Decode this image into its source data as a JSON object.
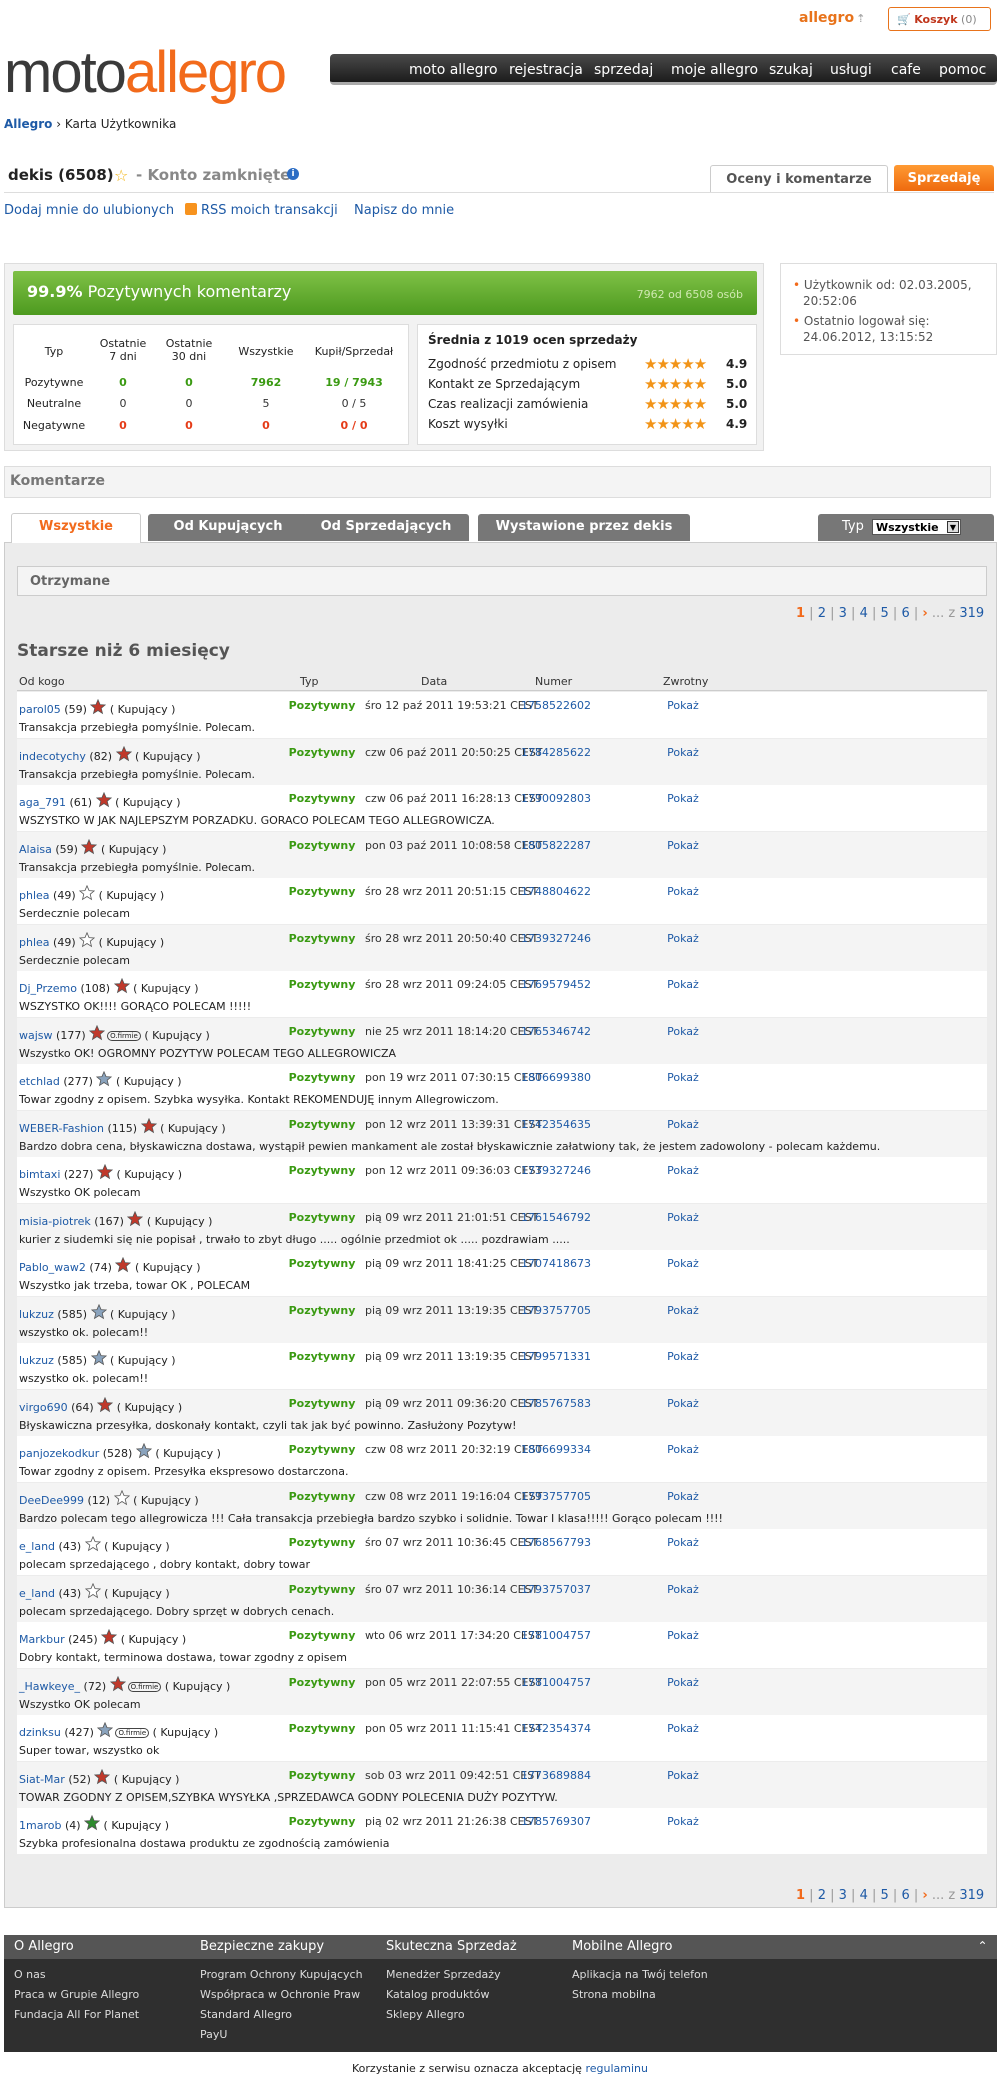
{
  "top": {
    "allegro_link": "allegro",
    "cart_label": "Koszyk",
    "cart_count": "(0)"
  },
  "logo": {
    "part1": "moto",
    "part2": "allegro"
  },
  "nav": [
    "moto allegro",
    "rejestracja",
    "sprzedaj",
    "moje allegro",
    "szukaj",
    "usługi",
    "cafe",
    "pomoc"
  ],
  "breadcrumb": {
    "root": "Allegro",
    "sep": "›",
    "current": "Karta Użytkownika"
  },
  "user": {
    "name": "dekis (6508)",
    "status": "- Konto zamknięte",
    "tab_oceny": "Oceny i komentarze",
    "tab_sprzedaje": "Sprzedaję"
  },
  "actions": {
    "fav": "Dodaj mnie do ulubionych",
    "rss": "RSS moich transakcji",
    "write": "Napisz do mnie"
  },
  "summary": {
    "percent": "99.9%",
    "positive_label": "Pozytywnych komentarzy",
    "count_text": "7962 od 6508 osób",
    "headers": [
      "Typ",
      "Ostatnie 7 dni",
      "Ostatnie 30 dni",
      "Wszystkie",
      "Kupił/Sprzedał"
    ],
    "rows": [
      {
        "typ": "Pozytywne",
        "d7": "0",
        "d30": "0",
        "all": "7962",
        "ks": "19 / 7943",
        "color": "#3a9a12"
      },
      {
        "typ": "Neutralne",
        "d7": "0",
        "d30": "0",
        "all": "5",
        "ks": "0 / 5",
        "color": "#333333"
      },
      {
        "typ": "Negatywne",
        "d7": "0",
        "d30": "0",
        "all": "0",
        "ks": "0 / 0",
        "color": "#e53b17"
      }
    ],
    "ratings_title": "Średnia z 1019 ocen sprzedaży",
    "ratings": [
      {
        "label": "Zgodność przedmiotu z opisem",
        "value": "4.9",
        "stars": "★★★★★"
      },
      {
        "label": "Kontakt ze Sprzedającym",
        "value": "5.0",
        "stars": "★★★★★"
      },
      {
        "label": "Czas realizacji zamówienia",
        "value": "5.0",
        "stars": "★★★★★"
      },
      {
        "label": "Koszt wysyłki",
        "value": "4.9",
        "stars": "★★★★★"
      }
    ]
  },
  "side": {
    "since_label": "Użytkownik od: 02.03.2005,",
    "since_time": "20:52:06",
    "last_label": "Ostatnio logował się:",
    "last_time": "24.06.2012, 13:15:52"
  },
  "komentarze": "Komentarze",
  "tabs": [
    "Wszystkie",
    "Od Kupujących",
    "Od Sprzedających",
    "Wystawione przez dekis"
  ],
  "typ_label": "Typ",
  "typ_value": "Wszystkie",
  "otrzymane": "Otrzymane",
  "pager": {
    "current": "1",
    "pages": [
      "2",
      "3",
      "4",
      "5",
      "6"
    ],
    "dots": "... z",
    "total": "319"
  },
  "older": "Starsze niż 6 miesięcy",
  "columns": [
    "Od kogo",
    "Typ",
    "Data",
    "Numer",
    "Zwrotny"
  ],
  "rows": [
    {
      "user": "parol05",
      "count": "(59)",
      "role": "( Kupujący )",
      "typ": "Pozytywny",
      "date": "śro 12 paź 2011 19:53:21 CEST",
      "num": "1758522602",
      "zw": "Pokaż",
      "text": "Transakcja przebiegła pomyślnie. Polecam.",
      "star": "#c0392b",
      "badge": ""
    },
    {
      "user": "indecotychy",
      "count": "(82)",
      "role": "( Kupujący )",
      "typ": "Pozytywny",
      "date": "czw 06 paź 2011 20:50:25 CEST",
      "num": "1784285622",
      "zw": "Pokaż",
      "text": "Transakcja przebiegła pomyślnie. Polecam.",
      "star": "#c0392b",
      "badge": ""
    },
    {
      "user": "aga_791",
      "count": "(61)",
      "role": "( Kupujący )",
      "typ": "Pozytywny",
      "date": "czw 06 paź 2011 16:28:13 CEST",
      "num": "1790092803",
      "zw": "Pokaż",
      "text": "WSZYSTKO W JAK NAJLEPSZYM PORZADKU. GORACO POLECAM TEGO ALLEGROWICZA.",
      "star": "#c0392b",
      "badge": ""
    },
    {
      "user": "Alaisa",
      "count": "(59)",
      "role": "( Kupujący )",
      "typ": "Pozytywny",
      "date": "pon 03 paź 2011 10:08:58 CEST",
      "num": "1805822287",
      "zw": "Pokaż",
      "text": "Transakcja przebiegła pomyślnie. Polecam.",
      "star": "#c0392b",
      "badge": ""
    },
    {
      "user": "phlea",
      "count": "(49)",
      "role": "( Kupujący )",
      "typ": "Pozytywny",
      "date": "śro 28 wrz 2011 20:51:15 CEST",
      "num": "1748804622",
      "zw": "Pokaż",
      "text": "Serdecznie polecam",
      "star": "#ffffff",
      "badge": ""
    },
    {
      "user": "phlea",
      "count": "(49)",
      "role": "( Kupujący )",
      "typ": "Pozytywny",
      "date": "śro 28 wrz 2011 20:50:40 CEST",
      "num": "1739327246",
      "zw": "Pokaż",
      "text": "Serdecznie polecam",
      "star": "#ffffff",
      "badge": ""
    },
    {
      "user": "Dj_Przemo",
      "count": "(108)",
      "role": "( Kupujący )",
      "typ": "Pozytywny",
      "date": "śro 28 wrz 2011 09:24:05 CEST",
      "num": "1769579452",
      "zw": "Pokaż",
      "text": "WSZYSTKO OK!!!! GORĄCO POLECAM !!!!!",
      "star": "#c0392b",
      "badge": ""
    },
    {
      "user": "wajsw",
      "count": "(177)",
      "role": "( Kupujący )",
      "typ": "Pozytywny",
      "date": "nie 25 wrz 2011 18:14:20 CEST",
      "num": "1765346742",
      "zw": "Pokaż",
      "text": "Wszystko OK! OGROMNY POZYTYW POLECAM TEGO ALLEGROWICZA",
      "star": "#c0392b",
      "badge": "O.firmie"
    },
    {
      "user": "etchlad",
      "count": "(277)",
      "role": "( Kupujący )",
      "typ": "Pozytywny",
      "date": "pon 19 wrz 2011 07:30:15 CEST",
      "num": "1806699380",
      "zw": "Pokaż",
      "text": "Towar zgodny z opisem. Szybka wysyłka. Kontakt REKOMENDUJĘ innym Allegrowiczom.",
      "star": "#8aa3bd",
      "badge": ""
    },
    {
      "user": "WEBER-Fashion",
      "count": "(115)",
      "role": "( Kupujący )",
      "typ": "Pozytywny",
      "date": "pon 12 wrz 2011 13:39:31 CEST",
      "num": "1742354635",
      "zw": "Pokaż",
      "text": "Bardzo dobra cena, błyskawiczna dostawa, wystąpił pewien mankament ale został błyskawicznie załatwiony tak, że jestem zadowolony - polecam każdemu.",
      "star": "#c0392b",
      "badge": ""
    },
    {
      "user": "bimtaxi",
      "count": "(227)",
      "role": "( Kupujący )",
      "typ": "Pozytywny",
      "date": "pon 12 wrz 2011 09:36:03 CEST",
      "num": "1739327246",
      "zw": "Pokaż",
      "text": "Wszystko OK polecam",
      "star": "#c0392b",
      "badge": ""
    },
    {
      "user": "misia-piotrek",
      "count": "(167)",
      "role": "( Kupujący )",
      "typ": "Pozytywny",
      "date": "pią 09 wrz 2011 21:01:51 CEST",
      "num": "1761546792",
      "zw": "Pokaż",
      "text": "kurier z siudemki się nie popisał , trwało to zbyt długo ..... ogólnie przedmiot ok ..... pozdrawiam .....",
      "star": "#c0392b",
      "badge": ""
    },
    {
      "user": "Pablo_waw2",
      "count": "(74)",
      "role": "( Kupujący )",
      "typ": "Pozytywny",
      "date": "pią 09 wrz 2011 18:41:25 CEST",
      "num": "1707418673",
      "zw": "Pokaż",
      "text": "Wszystko jak trzeba, towar OK , POLECAM",
      "star": "#c0392b",
      "badge": ""
    },
    {
      "user": "lukzuz",
      "count": "(585)",
      "role": "( Kupujący )",
      "typ": "Pozytywny",
      "date": "pią 09 wrz 2011 13:19:35 CEST",
      "num": "1793757705",
      "zw": "Pokaż",
      "text": "wszystko ok. polecam!!",
      "star": "#8aa3bd",
      "badge": ""
    },
    {
      "user": "lukzuz",
      "count": "(585)",
      "role": "( Kupujący )",
      "typ": "Pozytywny",
      "date": "pią 09 wrz 2011 13:19:35 CEST",
      "num": "1799571331",
      "zw": "Pokaż",
      "text": "wszystko ok. polecam!!",
      "star": "#8aa3bd",
      "badge": ""
    },
    {
      "user": "virgo690",
      "count": "(64)",
      "role": "( Kupujący )",
      "typ": "Pozytywny",
      "date": "pią 09 wrz 2011 09:36:20 CEST",
      "num": "1785767583",
      "zw": "Pokaż",
      "text": "Błyskawiczna przesyłka, doskonały kontakt, czyli tak jak być powinno. Zasłużony Pozytyw!",
      "star": "#c0392b",
      "badge": ""
    },
    {
      "user": "panjozekodkur",
      "count": "(528)",
      "role": "( Kupujący )",
      "typ": "Pozytywny",
      "date": "czw 08 wrz 2011 20:32:19 CEST",
      "num": "1806699334",
      "zw": "Pokaż",
      "text": "Towar zgodny z opisem. Przesyłka ekspresowo dostarczona.",
      "star": "#8aa3bd",
      "badge": ""
    },
    {
      "user": "DeeDee999",
      "count": "(12)",
      "role": "( Kupujący )",
      "typ": "Pozytywny",
      "date": "czw 08 wrz 2011 19:16:04 CEST",
      "num": "1793757705",
      "zw": "Pokaż",
      "text": "Bardzo polecam tego allegrowicza !!! Cała transakcja przebiegła bardzo szybko i solidnie. Towar I klasa!!!!! Gorąco polecam !!!!",
      "star": "#ffffff",
      "badge": ""
    },
    {
      "user": "e_land",
      "count": "(43)",
      "role": "( Kupujący )",
      "typ": "Pozytywny",
      "date": "śro 07 wrz 2011 10:36:45 CEST",
      "num": "1768567793",
      "zw": "Pokaż",
      "text": "polecam sprzedającego , dobry kontakt, dobry towar",
      "star": "#ffffff",
      "badge": ""
    },
    {
      "user": "e_land",
      "count": "(43)",
      "role": "( Kupujący )",
      "typ": "Pozytywny",
      "date": "śro 07 wrz 2011 10:36:14 CEST",
      "num": "1793757037",
      "zw": "Pokaż",
      "text": "polecam sprzedającego. Dobry sprzęt w dobrych cenach.",
      "star": "#ffffff",
      "badge": ""
    },
    {
      "user": "Markbur",
      "count": "(245)",
      "role": "( Kupujący )",
      "typ": "Pozytywny",
      "date": "wto 06 wrz 2011 17:34:20 CEST",
      "num": "1781004757",
      "zw": "Pokaż",
      "text": "Dobry kontakt, terminowa dostawa, towar zgodny z opisem",
      "star": "#c0392b",
      "badge": ""
    },
    {
      "user": "_Hawkeye_",
      "count": "(72)",
      "role": "( Kupujący )",
      "typ": "Pozytywny",
      "date": "pon 05 wrz 2011 22:07:55 CEST",
      "num": "1781004757",
      "zw": "Pokaż",
      "text": "Wszystko OK polecam",
      "star": "#c0392b",
      "badge": "O.firmie"
    },
    {
      "user": "dzinksu",
      "count": "(427)",
      "role": "( Kupujący )",
      "typ": "Pozytywny",
      "date": "pon 05 wrz 2011 11:15:41 CEST",
      "num": "1742354374",
      "zw": "Pokaż",
      "text": "Super towar, wszystko ok",
      "star": "#8aa3bd",
      "badge": "O.firmie"
    },
    {
      "user": "Siat-Mar",
      "count": "(52)",
      "role": "( Kupujący )",
      "typ": "Pozytywny",
      "date": "sob 03 wrz 2011 09:42:51 CEST",
      "num": "1773689884",
      "zw": "Pokaż",
      "text": "TOWAR ZGODNY Z OPISEM,SZYBKA WYSYŁKA ,SPRZEDAWCA GODNY POLECENIA DUŻY POZYTYW.",
      "star": "#c0392b",
      "badge": ""
    },
    {
      "user": "1marob",
      "count": "(4)",
      "role": "( Kupujący )",
      "typ": "Pozytywny",
      "date": "pią 02 wrz 2011 21:26:38 CEST",
      "num": "1785769307",
      "zw": "Pokaż",
      "text": "Szybka profesionalna dostawa produktu ze zgodnością zamówienia",
      "star": "#2e8b2e",
      "badge": ""
    }
  ],
  "footer": {
    "cols": [
      {
        "title": "O Allegro",
        "items": [
          "O nas",
          "Praca w Grupie Allegro",
          "Fundacja All For Planet"
        ]
      },
      {
        "title": "Bezpieczne zakupy",
        "items": [
          "Program Ochrony Kupujących",
          "Współpraca w Ochronie Praw",
          "Standard Allegro",
          "PayU"
        ]
      },
      {
        "title": "Skuteczna Sprzedaż",
        "items": [
          "Menedżer Sprzedaży",
          "Katalog produktów",
          "Sklepy Allegro"
        ]
      },
      {
        "title": "Mobilne Allegro",
        "items": [
          "Aplikacja na Twój telefon",
          "Strona mobilna"
        ]
      }
    ]
  },
  "legal": {
    "text": "Korzystanie z serwisu oznacza akceptację",
    "link": "regulaminu"
  }
}
